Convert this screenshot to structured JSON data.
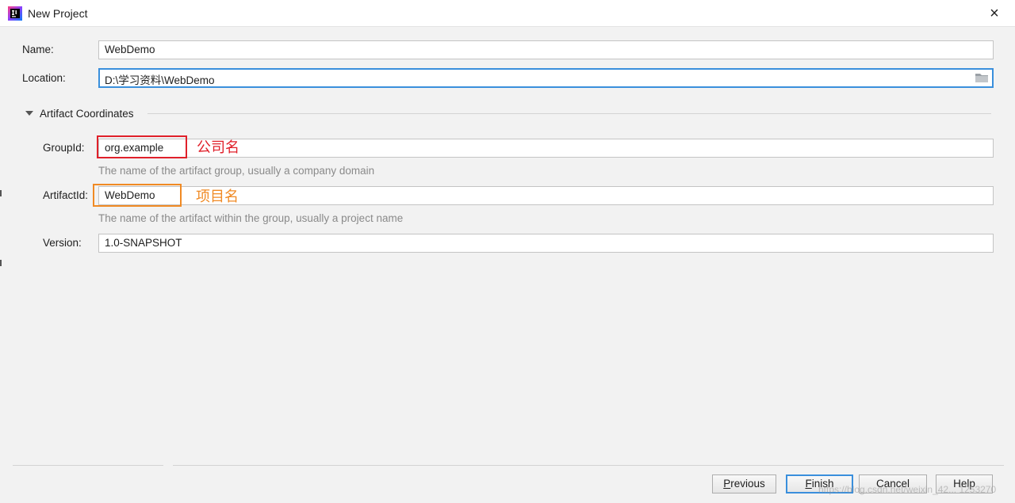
{
  "window": {
    "title": "New Project",
    "close_glyph": "×"
  },
  "form": {
    "name_label": "Name:",
    "name_value": "WebDemo",
    "location_label": "Location:",
    "location_value": "D:\\学习资料\\WebDemo"
  },
  "artifact": {
    "section_title": "Artifact Coordinates",
    "groupid_label": "GroupId:",
    "groupid_value": "org.example",
    "groupid_hint": "The name of the artifact group, usually a company domain",
    "artifactid_label": "ArtifactId:",
    "artifactid_value": "WebDemo",
    "artifactid_hint": "The name of the artifact within the group, usually a project name",
    "version_label": "Version:",
    "version_value": "1.0-SNAPSHOT"
  },
  "annotations": {
    "groupid_note": "公司名",
    "artifactid_note": "项目名",
    "groupid_color": "#e0202a",
    "artifactid_color": "#f08a24"
  },
  "buttons": {
    "previous_mnemonic": "P",
    "previous_rest": "revious",
    "finish_mnemonic": "F",
    "finish_rest": "inish",
    "cancel": "Cancel",
    "help": "Help"
  },
  "watermark": "https://blog.csdn.net/weixin_42... 1253270"
}
